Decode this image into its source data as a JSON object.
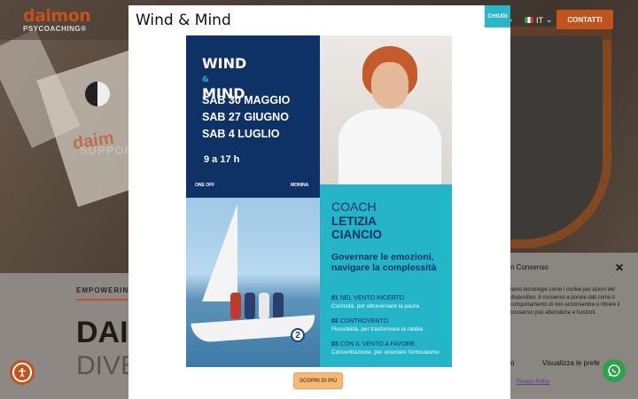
{
  "background": {
    "logo": {
      "main": "daimon",
      "sub": "PSYCOACHING®"
    },
    "header": {
      "lang": "IT",
      "contact_label": "CONTATTI"
    },
    "hero": {
      "ghost_logo": "daim",
      "support_text": "SUPPOR"
    },
    "eyebrow": "EMPOWERING P",
    "title_line1": "DAI",
    "title_line2": "DIVE"
  },
  "cookie": {
    "title": "n Consenso",
    "text": "iamo tecnologie come i cookie per azioni del dispositivo. Il consenso a porare dati come il comportamento di non acconsentire o ritirare il consenso può atteristiche e funzioni.",
    "accept_label": "o",
    "preferences_label": "Visualizza le prefe",
    "policy_prefix": "y",
    "policy_label": "Privacy Policy"
  },
  "modal": {
    "title": "Wind & Mind",
    "close_label": "CHIUDI",
    "more_label": "SCOPRI DI PIÙ",
    "poster": {
      "logo_line1": "WIND",
      "logo_amp": "&",
      "logo_line2": "MIND",
      "dates": [
        "SAB 30 MAGGIO",
        "SAB 27 GIUGNO",
        "SAB 4 LUGLIO"
      ],
      "hours": "9 a 17 h",
      "sponsor_left": "ONE OFF",
      "sponsor_right": "MONINA",
      "coach_label": "COACH",
      "coach_name_1": "LETIZIA",
      "coach_name_2": "CIANCIO",
      "headline": "Governare le emozioni, navigare la complessità",
      "items": [
        {
          "num": "01",
          "title": "NEL VENTO INCERTO",
          "desc": "Curiosità, per attraversare la paura"
        },
        {
          "num": "02",
          "title": "CONTROVENTO",
          "desc": "Flessibilità, per trasformare la rabbia"
        },
        {
          "num": "03",
          "title": "CON IL VENTO A FAVORE",
          "desc": "Concentrazione, per orientare l'entusiasmo"
        }
      ],
      "boat_number": "2"
    }
  },
  "colors": {
    "brand_orange": "#c3531c",
    "navy": "#0f3266",
    "cyan": "#24b5c9",
    "whatsapp": "#2aa34a"
  }
}
